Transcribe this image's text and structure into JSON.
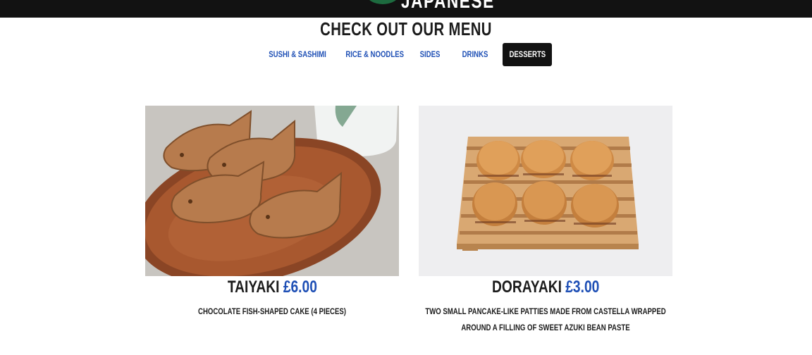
{
  "header": {
    "logo_text": "JAPANESE"
  },
  "menu": {
    "title": "CHECK OUT OUR MENU",
    "tabs": [
      {
        "label": "SUSHI & SASHIMI",
        "active": false
      },
      {
        "label": "RICE & NOODLES",
        "active": false
      },
      {
        "label": "SIDES",
        "active": false
      },
      {
        "label": "DRINKS",
        "active": false
      },
      {
        "label": "DESSERTS",
        "active": true
      }
    ]
  },
  "items": [
    {
      "name": "TAIYAKI",
      "price": "£6.00",
      "description": "CHOCOLATE FISH-SHAPED CAKE (4 PIECES)",
      "photo_icon": "taiyaki-photo"
    },
    {
      "name": "DORAYAKI",
      "price": "£3.00",
      "description": "TWO SMALL PANCAKE-LIKE PATTIES MADE FROM CASTELLA WRAPPED AROUND A FILLING OF SWEET AZUKI BEAN PASTE",
      "photo_icon": "dorayaki-photo"
    }
  ],
  "colors": {
    "topbar": "#121212",
    "accent_blue": "#1e4fb5",
    "active_tab_bg": "#121212",
    "text_dark": "#1b1b1b"
  }
}
